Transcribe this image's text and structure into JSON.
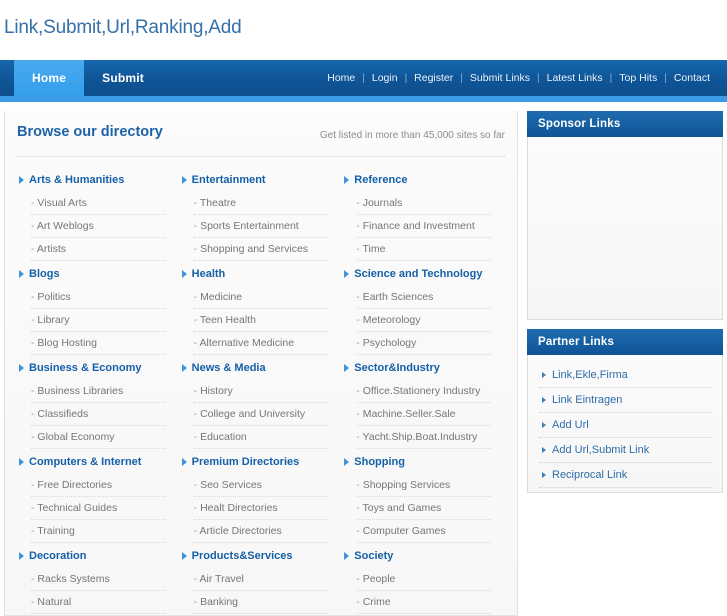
{
  "site": {
    "title": "Link,Submit,Url,Ranking,Add",
    "title_color": "#3670a8"
  },
  "navbar": {
    "tabs": [
      {
        "label": "Home",
        "active": true
      },
      {
        "label": "Submit",
        "active": false
      }
    ],
    "links": [
      "Home",
      "Login",
      "Register",
      "Submit Links",
      "Latest Links",
      "Top Hits",
      "Contact"
    ],
    "separator": "|",
    "background_color": "#0f5496",
    "active_tab_color": "#33a0ec",
    "underline_color": "#3d9ae8"
  },
  "directory": {
    "title": "Browse our directory",
    "note": "Get listed in more than 45,000 sites so far",
    "columns": [
      [
        {
          "title": "Arts & Humanities",
          "items": [
            "Visual Arts",
            "Art Weblogs",
            "Artists"
          ]
        },
        {
          "title": "Blogs",
          "items": [
            "Politics",
            "Library",
            "Blog Hosting"
          ]
        },
        {
          "title": "Business & Economy",
          "items": [
            "Business Libraries",
            "Classifieds",
            "Global Economy"
          ]
        },
        {
          "title": "Computers & Internet",
          "items": [
            "Free Directories",
            "Technical Guides",
            "Training"
          ]
        },
        {
          "title": "Decoration",
          "items": [
            "Racks Systems",
            "Natural"
          ]
        }
      ],
      [
        {
          "title": "Entertainment",
          "items": [
            "Theatre",
            "Sports Entertainment",
            "Shopping and Services"
          ]
        },
        {
          "title": "Health",
          "items": [
            "Medicine",
            "Teen Health",
            "Alternative Medicine"
          ]
        },
        {
          "title": "News & Media",
          "items": [
            "History",
            "College and University",
            "Education"
          ]
        },
        {
          "title": "Premium Directories",
          "items": [
            "Seo Services",
            "Healt Directories",
            "Article Directories"
          ]
        },
        {
          "title": "Products&Services",
          "items": [
            "Air Travel",
            "Banking"
          ]
        }
      ],
      [
        {
          "title": "Reference",
          "items": [
            "Journals",
            "Finance and Investment",
            "Time"
          ]
        },
        {
          "title": "Science and Technology",
          "items": [
            "Earth Sciences",
            "Meteorology",
            "Psychology"
          ]
        },
        {
          "title": "Sector&Industry",
          "items": [
            "Office.Stationery Industry",
            "Machine.Seller.Sale",
            "Yacht.Ship.Boat.Industry"
          ]
        },
        {
          "title": "Shopping",
          "items": [
            "Shopping Services",
            "Toys and Games",
            "Computer Games"
          ]
        },
        {
          "title": "Society",
          "items": [
            "People",
            "Crime"
          ]
        }
      ]
    ]
  },
  "sidebar": {
    "sponsor": {
      "title": "Sponsor Links",
      "items": []
    },
    "partner": {
      "title": "Partner Links",
      "items": [
        "Link,Ekle,Firma",
        "Link Eintragen",
        "Add Url",
        "Add Url,Submit Link",
        "Reciprocal Link"
      ]
    }
  }
}
